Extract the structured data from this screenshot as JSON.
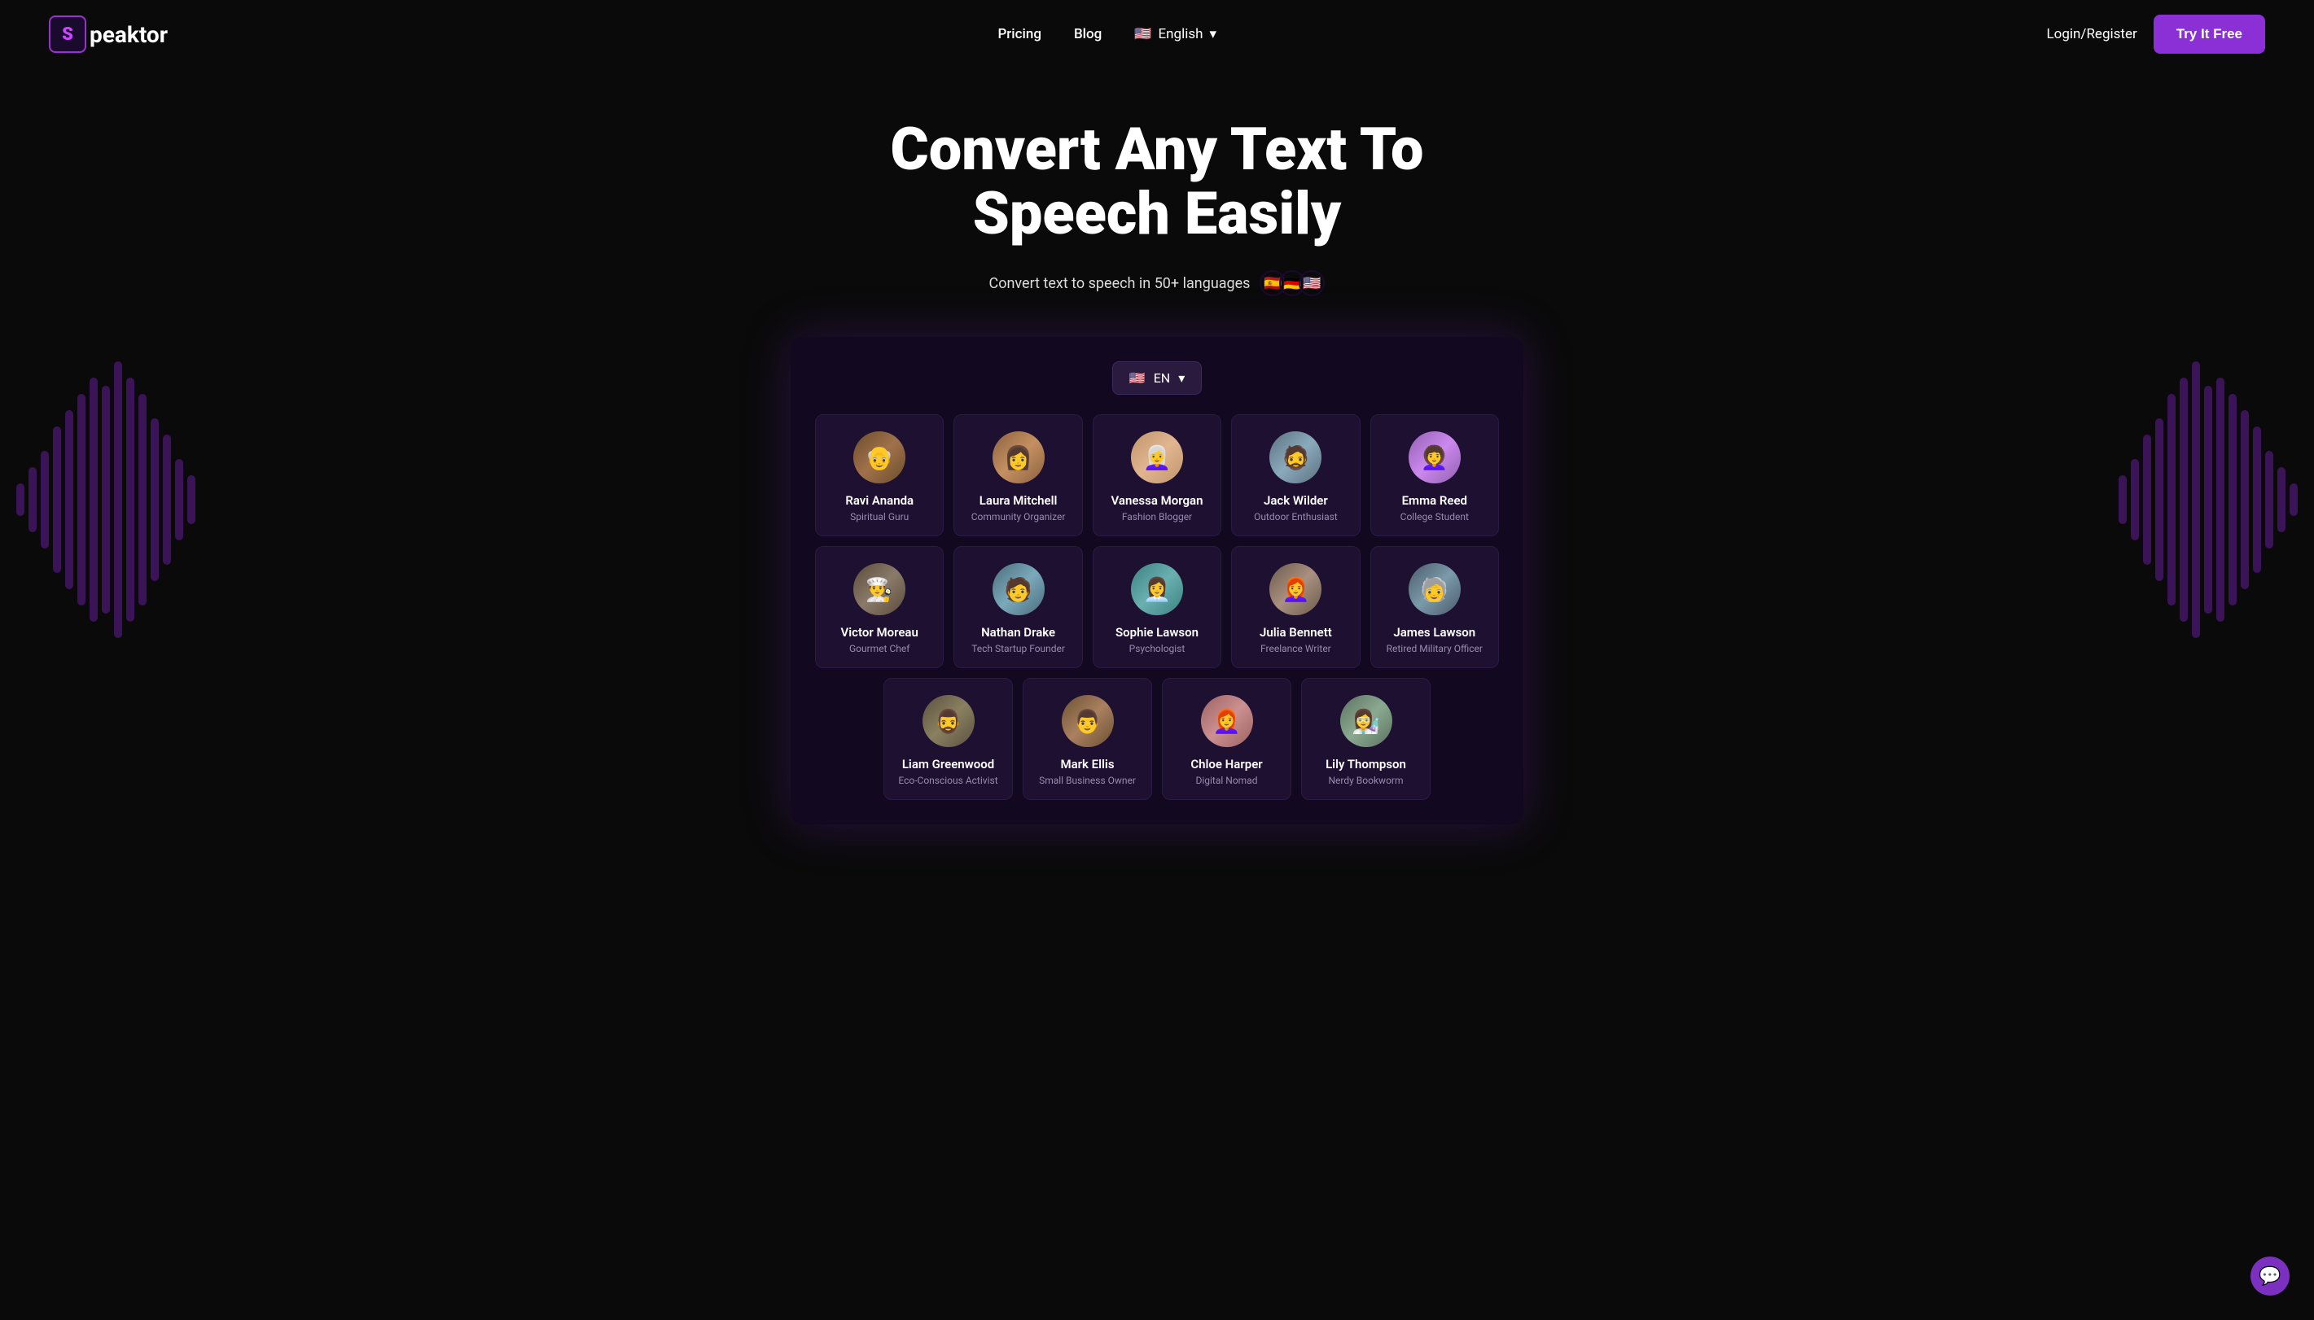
{
  "brand": {
    "logo_letter": "S",
    "name_prefix": "peaktor"
  },
  "navbar": {
    "pricing_label": "Pricing",
    "blog_label": "Blog",
    "language_label": "English",
    "language_code": "EN",
    "login_label": "Login/Register",
    "try_btn_label": "Try It Free"
  },
  "hero": {
    "headline": "Convert Any Text To Speech Easily",
    "subtitle": "Convert text to speech in 50+ languages",
    "flags": [
      "🇪🇸",
      "🇩🇪",
      "🇺🇸"
    ]
  },
  "app": {
    "lang_selector": {
      "flag": "🇺🇸",
      "code": "EN",
      "chevron": "▾"
    },
    "voices_row1": [
      {
        "id": "ravi",
        "name": "Ravi Ananda",
        "role": "Spiritual Guru",
        "emoji": "👴",
        "av": "av-ravi"
      },
      {
        "id": "laura",
        "name": "Laura Mitchell",
        "role": "Community Organizer",
        "emoji": "👩",
        "av": "av-laura"
      },
      {
        "id": "vanessa",
        "name": "Vanessa Morgan",
        "role": "Fashion Blogger",
        "emoji": "👩‍🦳",
        "av": "av-vanessa"
      },
      {
        "id": "jack",
        "name": "Jack Wilder",
        "role": "Outdoor Enthusiast",
        "emoji": "🧔",
        "av": "av-jack"
      },
      {
        "id": "emma",
        "name": "Emma Reed",
        "role": "College Student",
        "emoji": "👩‍🦱",
        "av": "av-emma"
      }
    ],
    "voices_row2": [
      {
        "id": "victor",
        "name": "Victor Moreau",
        "role": "Gourmet Chef",
        "emoji": "👨‍🍳",
        "av": "av-victor"
      },
      {
        "id": "nathan",
        "name": "Nathan Drake",
        "role": "Tech Startup Founder",
        "emoji": "🧑",
        "av": "av-nathan"
      },
      {
        "id": "sophie",
        "name": "Sophie Lawson",
        "role": "Psychologist",
        "emoji": "👩‍💼",
        "av": "av-sophie"
      },
      {
        "id": "julia",
        "name": "Julia Bennett",
        "role": "Freelance Writer",
        "emoji": "👩‍🦰",
        "av": "av-julia"
      },
      {
        "id": "james",
        "name": "James Lawson",
        "role": "Retired Military Officer",
        "emoji": "🧓",
        "av": "av-james"
      }
    ],
    "voices_row3": [
      {
        "id": "liam",
        "name": "Liam Greenwood",
        "role": "Eco-Conscious Activist",
        "emoji": "🧔‍♂️",
        "av": "av-liam"
      },
      {
        "id": "mark",
        "name": "Mark Ellis",
        "role": "Small Business Owner",
        "emoji": "👨",
        "av": "av-mark"
      },
      {
        "id": "chloe",
        "name": "Chloe Harper",
        "role": "Digital Nomad",
        "emoji": "👩‍🦰",
        "av": "av-chloe"
      },
      {
        "id": "lily",
        "name": "Lily Thompson",
        "role": "Nerdy Bookworm",
        "emoji": "👩‍🔬",
        "av": "av-lily"
      }
    ]
  },
  "chat": {
    "icon": "💬"
  }
}
